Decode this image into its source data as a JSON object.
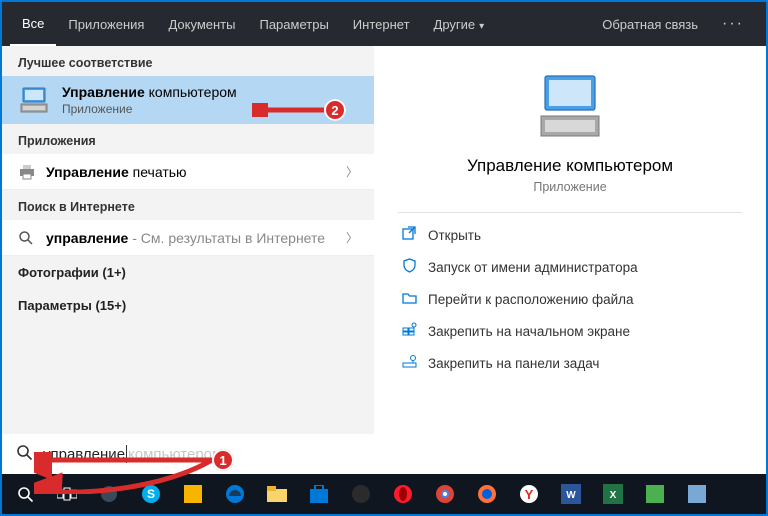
{
  "tabs": {
    "all": "Все",
    "apps": "Приложения",
    "docs": "Документы",
    "params": "Параметры",
    "internet": "Интернет",
    "other": "Другие"
  },
  "feedback": "Обратная связь",
  "sections": {
    "best": "Лучшее соответствие",
    "apps": "Приложения",
    "web": "Поиск в Интернете"
  },
  "best": {
    "title_bold": "Управление",
    "title_rest": " компьютером",
    "sub": "Приложение"
  },
  "appRow": {
    "bold": "Управление",
    "rest": " печатью"
  },
  "webRow": {
    "bold": "управление",
    "hint": " - См. результаты в Интернете"
  },
  "cats": {
    "photos": "Фотографии (1+)",
    "params": "Параметры (15+)"
  },
  "preview": {
    "title": "Управление компьютером",
    "sub": "Приложение"
  },
  "actions": {
    "open": "Открыть",
    "admin": "Запуск от имени администратора",
    "location": "Перейти к расположению файла",
    "pinStart": "Закрепить на начальном экране",
    "pinTask": "Закрепить на панели задач"
  },
  "search": {
    "typed": "управление",
    "ghost": " компьютером"
  },
  "markers": {
    "m1": "1",
    "m2": "2"
  }
}
